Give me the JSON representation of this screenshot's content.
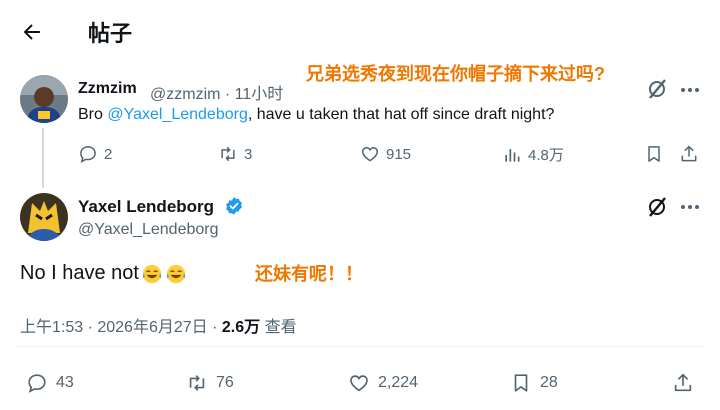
{
  "header": {
    "title": "帖子"
  },
  "annotations": {
    "top": "兄弟选秀夜到现在你帽子摘下来过吗?",
    "middle": "还妹有呢！！"
  },
  "parent_tweet": {
    "name": "Zzmzim",
    "handle_time": "@zzmzim · 11小时",
    "text_before": "Bro ",
    "mention": "@Yaxel_Lendeborg",
    "text_after": ", have u taken that hat off since draft night?",
    "replies": "2",
    "retweets": "3",
    "likes": "915",
    "views": "4.8万"
  },
  "main_tweet": {
    "name": "Yaxel Lendeborg",
    "handle": "@Yaxel_Lendeborg",
    "text": "No I have not",
    "time_date": "上午1:53 · 2026年6月27日 · ",
    "views_count": "2.6万",
    "views_label": " 查看",
    "replies": "43",
    "retweets": "76",
    "likes": "2,224",
    "bookmarks": "28"
  },
  "colors": {
    "accent": "#1d9bf0",
    "annotation": "#f07800",
    "secondary_text": "#536471"
  },
  "icons": [
    "back-arrow-icon",
    "grok-icon",
    "more-icon",
    "reply-icon",
    "retweet-icon",
    "like-icon",
    "views-icon",
    "bookmark-icon",
    "share-icon",
    "verified-icon",
    "crying-laugh-emoji-icon"
  ]
}
